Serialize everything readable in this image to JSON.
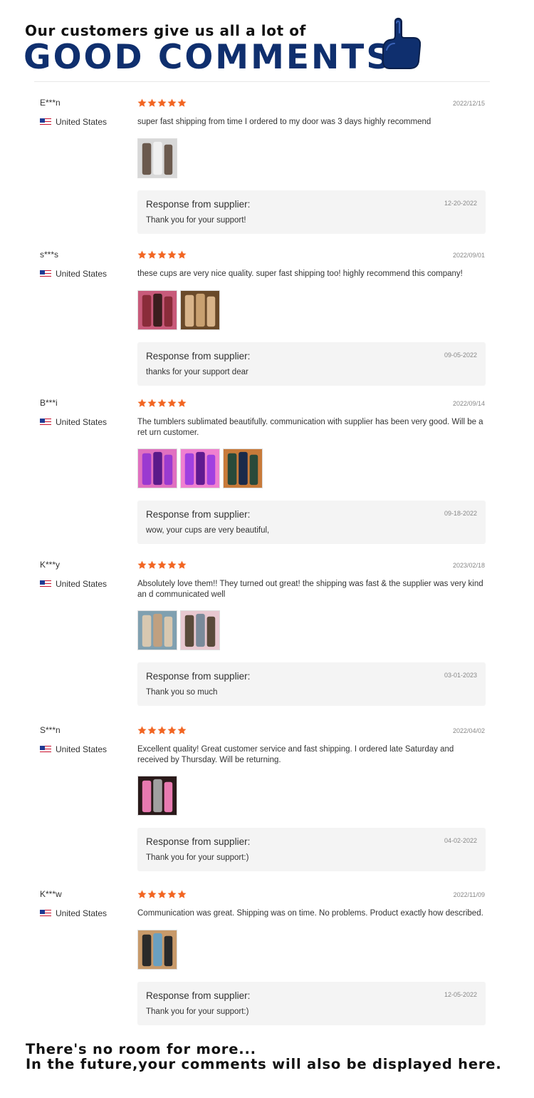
{
  "header": {
    "subtitle": "Our customers give us all a lot of",
    "headline": "GOOD COMMENTS",
    "icon": "thumbs-up-icon",
    "brand_color": "#0f2f6e"
  },
  "star_color": "#f26522",
  "flag_icon": "us-flag-icon",
  "response_label": "Response from supplier:",
  "reviews": [
    {
      "name": "E***n",
      "country": "United States",
      "rating": 5,
      "date": "2022/12/15",
      "text": "super fast shipping from time I ordered to my door was 3 days highly recommend",
      "photo_count": 1,
      "response_date": "12-20-2022",
      "response": "Thank you for your support!"
    },
    {
      "name": "s***s",
      "country": "United States",
      "rating": 5,
      "date": "2022/09/01",
      "text": "these cups are very nice quality. super fast shipping too! highly recommend this company!",
      "photo_count": 2,
      "response_date": "09-05-2022",
      "response": "thanks for your support dear"
    },
    {
      "name": "B***i",
      "country": "United States",
      "rating": 5,
      "date": "2022/09/14",
      "text": "The tumblers sublimated beautifully. communication with supplier has been very good. Will be a ret urn customer.",
      "photo_count": 3,
      "response_date": "09-18-2022",
      "response": "wow, your cups are very beautiful,"
    },
    {
      "name": "K***y",
      "country": "United States",
      "rating": 5,
      "date": "2023/02/18",
      "text": "Absolutely love them!! They turned out great! the shipping was fast & the supplier was very kind an d communicated well",
      "photo_count": 2,
      "response_date": "03-01-2023",
      "response": "Thank you so much"
    },
    {
      "name": "S***n",
      "country": "United States",
      "rating": 5,
      "date": "2022/04/02",
      "text": "Excellent quality! Great customer service and fast shipping. I ordered late Saturday and received by Thursday. Will be returning.",
      "photo_count": 1,
      "response_date": "04-02-2022",
      "response": "Thank you for your support:)"
    },
    {
      "name": "K***w",
      "country": "United States",
      "rating": 5,
      "date": "2022/11/09",
      "text": "Communication was great. Shipping was on time. No problems. Product exactly how described.",
      "photo_count": 1,
      "response_date": "12-05-2022",
      "response": "Thank you for your support:)"
    }
  ],
  "footer": {
    "line1": "There's no room for more...",
    "line2": "In the future,your comments will also be displayed here."
  }
}
